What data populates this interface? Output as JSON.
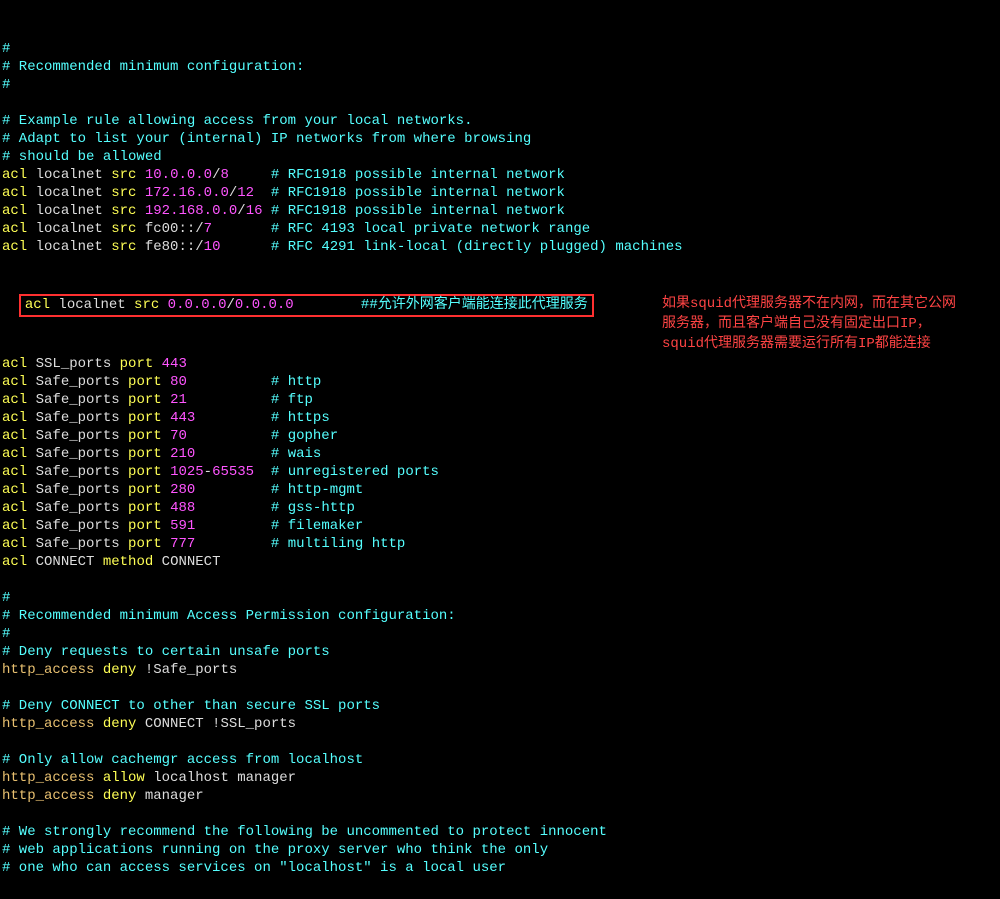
{
  "lines": [
    [
      {
        "cls": "c-cyan",
        "t": "#"
      }
    ],
    [
      {
        "cls": "c-cyan",
        "t": "# Recommended minimum configuration:"
      }
    ],
    [
      {
        "cls": "c-cyan",
        "t": "#"
      }
    ],
    [
      {
        "cls": "",
        "t": ""
      }
    ],
    [
      {
        "cls": "c-cyan",
        "t": "# Example rule allowing access from your local networks."
      }
    ],
    [
      {
        "cls": "c-cyan",
        "t": "# Adapt to list your (internal) IP networks from where browsing"
      }
    ],
    [
      {
        "cls": "c-cyan",
        "t": "# should be allowed"
      }
    ],
    [
      {
        "cls": "c-yellow",
        "t": "acl"
      },
      {
        "cls": "c-white",
        "t": " localnet "
      },
      {
        "cls": "c-yellow",
        "t": "src"
      },
      {
        "cls": "c-white",
        "t": " "
      },
      {
        "cls": "c-magenta",
        "t": "10.0.0.0"
      },
      {
        "cls": "c-white",
        "t": "/"
      },
      {
        "cls": "c-magenta",
        "t": "8"
      },
      {
        "cls": "c-white",
        "t": "     "
      },
      {
        "cls": "c-cyan",
        "t": "# RFC1918 possible internal network"
      }
    ],
    [
      {
        "cls": "c-yellow",
        "t": "acl"
      },
      {
        "cls": "c-white",
        "t": " localnet "
      },
      {
        "cls": "c-yellow",
        "t": "src"
      },
      {
        "cls": "c-white",
        "t": " "
      },
      {
        "cls": "c-magenta",
        "t": "172.16.0.0"
      },
      {
        "cls": "c-white",
        "t": "/"
      },
      {
        "cls": "c-magenta",
        "t": "12"
      },
      {
        "cls": "c-white",
        "t": "  "
      },
      {
        "cls": "c-cyan",
        "t": "# RFC1918 possible internal network"
      }
    ],
    [
      {
        "cls": "c-yellow",
        "t": "acl"
      },
      {
        "cls": "c-white",
        "t": " localnet "
      },
      {
        "cls": "c-yellow",
        "t": "src"
      },
      {
        "cls": "c-white",
        "t": " "
      },
      {
        "cls": "c-magenta",
        "t": "192.168.0.0"
      },
      {
        "cls": "c-white",
        "t": "/"
      },
      {
        "cls": "c-magenta",
        "t": "16"
      },
      {
        "cls": "c-white",
        "t": " "
      },
      {
        "cls": "c-cyan",
        "t": "# RFC1918 possible internal network"
      }
    ],
    [
      {
        "cls": "c-yellow",
        "t": "acl"
      },
      {
        "cls": "c-white",
        "t": " localnet "
      },
      {
        "cls": "c-yellow",
        "t": "src"
      },
      {
        "cls": "c-white",
        "t": " fc00::/"
      },
      {
        "cls": "c-magenta",
        "t": "7"
      },
      {
        "cls": "c-white",
        "t": "       "
      },
      {
        "cls": "c-cyan",
        "t": "# RFC 4193 local private network range"
      }
    ],
    [
      {
        "cls": "c-yellow",
        "t": "acl"
      },
      {
        "cls": "c-white",
        "t": " localnet "
      },
      {
        "cls": "c-yellow",
        "t": "src"
      },
      {
        "cls": "c-white",
        "t": " fe80::/"
      },
      {
        "cls": "c-magenta",
        "t": "10"
      },
      {
        "cls": "c-white",
        "t": "      "
      },
      {
        "cls": "c-cyan",
        "t": "# RFC 4291 link-local (directly plugged) machines"
      }
    ],
    [
      {
        "cls": "",
        "t": ""
      }
    ]
  ],
  "hl": [
    {
      "cls": "c-yellow",
      "t": "acl"
    },
    {
      "cls": "c-white",
      "t": " localnet "
    },
    {
      "cls": "c-yellow",
      "t": "src"
    },
    {
      "cls": "c-white",
      "t": " "
    },
    {
      "cls": "c-magenta",
      "t": "0.0.0.0"
    },
    {
      "cls": "c-white",
      "t": "/"
    },
    {
      "cls": "c-magenta",
      "t": "0.0.0.0"
    },
    {
      "cls": "c-white",
      "t": "        "
    },
    {
      "cls": "c-cyan",
      "t": "##允许外网客户端能连接此代理服务"
    }
  ],
  "lines2": [
    [
      {
        "cls": "",
        "t": ""
      }
    ],
    [
      {
        "cls": "c-yellow",
        "t": "acl"
      },
      {
        "cls": "c-white",
        "t": " SSL_ports "
      },
      {
        "cls": "c-yellow",
        "t": "port"
      },
      {
        "cls": "c-white",
        "t": " "
      },
      {
        "cls": "c-magenta",
        "t": "443"
      }
    ],
    [
      {
        "cls": "c-yellow",
        "t": "acl"
      },
      {
        "cls": "c-white",
        "t": " Safe_ports "
      },
      {
        "cls": "c-yellow",
        "t": "port"
      },
      {
        "cls": "c-white",
        "t": " "
      },
      {
        "cls": "c-magenta",
        "t": "80"
      },
      {
        "cls": "c-white",
        "t": "          "
      },
      {
        "cls": "c-cyan",
        "t": "# http"
      }
    ],
    [
      {
        "cls": "c-yellow",
        "t": "acl"
      },
      {
        "cls": "c-white",
        "t": " Safe_ports "
      },
      {
        "cls": "c-yellow",
        "t": "port"
      },
      {
        "cls": "c-white",
        "t": " "
      },
      {
        "cls": "c-magenta",
        "t": "21"
      },
      {
        "cls": "c-white",
        "t": "          "
      },
      {
        "cls": "c-cyan",
        "t": "# ftp"
      }
    ],
    [
      {
        "cls": "c-yellow",
        "t": "acl"
      },
      {
        "cls": "c-white",
        "t": " Safe_ports "
      },
      {
        "cls": "c-yellow",
        "t": "port"
      },
      {
        "cls": "c-white",
        "t": " "
      },
      {
        "cls": "c-magenta",
        "t": "443"
      },
      {
        "cls": "c-white",
        "t": "         "
      },
      {
        "cls": "c-cyan",
        "t": "# https"
      }
    ],
    [
      {
        "cls": "c-yellow",
        "t": "acl"
      },
      {
        "cls": "c-white",
        "t": " Safe_ports "
      },
      {
        "cls": "c-yellow",
        "t": "port"
      },
      {
        "cls": "c-white",
        "t": " "
      },
      {
        "cls": "c-magenta",
        "t": "70"
      },
      {
        "cls": "c-white",
        "t": "          "
      },
      {
        "cls": "c-cyan",
        "t": "# gopher"
      }
    ],
    [
      {
        "cls": "c-yellow",
        "t": "acl"
      },
      {
        "cls": "c-white",
        "t": " Safe_ports "
      },
      {
        "cls": "c-yellow",
        "t": "port"
      },
      {
        "cls": "c-white",
        "t": " "
      },
      {
        "cls": "c-magenta",
        "t": "210"
      },
      {
        "cls": "c-white",
        "t": "         "
      },
      {
        "cls": "c-cyan",
        "t": "# wais"
      }
    ],
    [
      {
        "cls": "c-yellow",
        "t": "acl"
      },
      {
        "cls": "c-white",
        "t": " Safe_ports "
      },
      {
        "cls": "c-yellow",
        "t": "port"
      },
      {
        "cls": "c-white",
        "t": " "
      },
      {
        "cls": "c-magenta",
        "t": "1025"
      },
      {
        "cls": "c-white",
        "t": "-"
      },
      {
        "cls": "c-magenta",
        "t": "65535"
      },
      {
        "cls": "c-white",
        "t": "  "
      },
      {
        "cls": "c-cyan",
        "t": "# unregistered ports"
      }
    ],
    [
      {
        "cls": "c-yellow",
        "t": "acl"
      },
      {
        "cls": "c-white",
        "t": " Safe_ports "
      },
      {
        "cls": "c-yellow",
        "t": "port"
      },
      {
        "cls": "c-white",
        "t": " "
      },
      {
        "cls": "c-magenta",
        "t": "280"
      },
      {
        "cls": "c-white",
        "t": "         "
      },
      {
        "cls": "c-cyan",
        "t": "# http-mgmt"
      }
    ],
    [
      {
        "cls": "c-yellow",
        "t": "acl"
      },
      {
        "cls": "c-white",
        "t": " Safe_ports "
      },
      {
        "cls": "c-yellow",
        "t": "port"
      },
      {
        "cls": "c-white",
        "t": " "
      },
      {
        "cls": "c-magenta",
        "t": "488"
      },
      {
        "cls": "c-white",
        "t": "         "
      },
      {
        "cls": "c-cyan",
        "t": "# gss-http"
      }
    ],
    [
      {
        "cls": "c-yellow",
        "t": "acl"
      },
      {
        "cls": "c-white",
        "t": " Safe_ports "
      },
      {
        "cls": "c-yellow",
        "t": "port"
      },
      {
        "cls": "c-white",
        "t": " "
      },
      {
        "cls": "c-magenta",
        "t": "591"
      },
      {
        "cls": "c-white",
        "t": "         "
      },
      {
        "cls": "c-cyan",
        "t": "# filemaker"
      }
    ],
    [
      {
        "cls": "c-yellow",
        "t": "acl"
      },
      {
        "cls": "c-white",
        "t": " Safe_ports "
      },
      {
        "cls": "c-yellow",
        "t": "port"
      },
      {
        "cls": "c-white",
        "t": " "
      },
      {
        "cls": "c-magenta",
        "t": "777"
      },
      {
        "cls": "c-white",
        "t": "         "
      },
      {
        "cls": "c-cyan",
        "t": "# multiling http"
      }
    ],
    [
      {
        "cls": "c-yellow",
        "t": "acl"
      },
      {
        "cls": "c-white",
        "t": " CONNECT "
      },
      {
        "cls": "c-yellow",
        "t": "method"
      },
      {
        "cls": "c-white",
        "t": " CONNECT"
      }
    ],
    [
      {
        "cls": "",
        "t": ""
      }
    ],
    [
      {
        "cls": "c-cyan",
        "t": "#"
      }
    ],
    [
      {
        "cls": "c-cyan",
        "t": "# Recommended minimum Access Permission configuration:"
      }
    ],
    [
      {
        "cls": "c-cyan",
        "t": "#"
      }
    ],
    [
      {
        "cls": "c-cyan",
        "t": "# Deny requests to certain unsafe ports"
      }
    ],
    [
      {
        "cls": "c-cfgkey",
        "t": "http_access"
      },
      {
        "cls": "c-white",
        "t": " "
      },
      {
        "cls": "c-yellow",
        "t": "deny"
      },
      {
        "cls": "c-white",
        "t": " !Safe_ports"
      }
    ],
    [
      {
        "cls": "",
        "t": ""
      }
    ],
    [
      {
        "cls": "c-cyan",
        "t": "# Deny CONNECT to other than secure SSL ports"
      }
    ],
    [
      {
        "cls": "c-cfgkey",
        "t": "http_access"
      },
      {
        "cls": "c-white",
        "t": " "
      },
      {
        "cls": "c-yellow",
        "t": "deny"
      },
      {
        "cls": "c-white",
        "t": " CONNECT !SSL_ports"
      }
    ],
    [
      {
        "cls": "",
        "t": ""
      }
    ],
    [
      {
        "cls": "c-cyan",
        "t": "# Only allow cachemgr access from localhost"
      }
    ],
    [
      {
        "cls": "c-cfgkey",
        "t": "http_access"
      },
      {
        "cls": "c-white",
        "t": " "
      },
      {
        "cls": "c-yellow",
        "t": "allow"
      },
      {
        "cls": "c-white",
        "t": " localhost manager"
      }
    ],
    [
      {
        "cls": "c-cfgkey",
        "t": "http_access"
      },
      {
        "cls": "c-white",
        "t": " "
      },
      {
        "cls": "c-yellow",
        "t": "deny"
      },
      {
        "cls": "c-white",
        "t": " manager"
      }
    ],
    [
      {
        "cls": "",
        "t": ""
      }
    ],
    [
      {
        "cls": "c-cyan",
        "t": "# We strongly recommend the following be uncommented to protect innocent"
      }
    ],
    [
      {
        "cls": "c-cyan",
        "t": "# web applications running on the proxy server who think the only"
      }
    ],
    [
      {
        "cls": "c-cyan",
        "t": "# one who can access services on \"localhost\" is a local user"
      }
    ]
  ],
  "annotation": {
    "l1": "如果squid代理服务器不在内网，而在其它公网",
    "l2": "服务器，而且客户端自己没有固定出口IP，",
    "l3": "squid代理服务器需要运行所有IP都能连接"
  }
}
